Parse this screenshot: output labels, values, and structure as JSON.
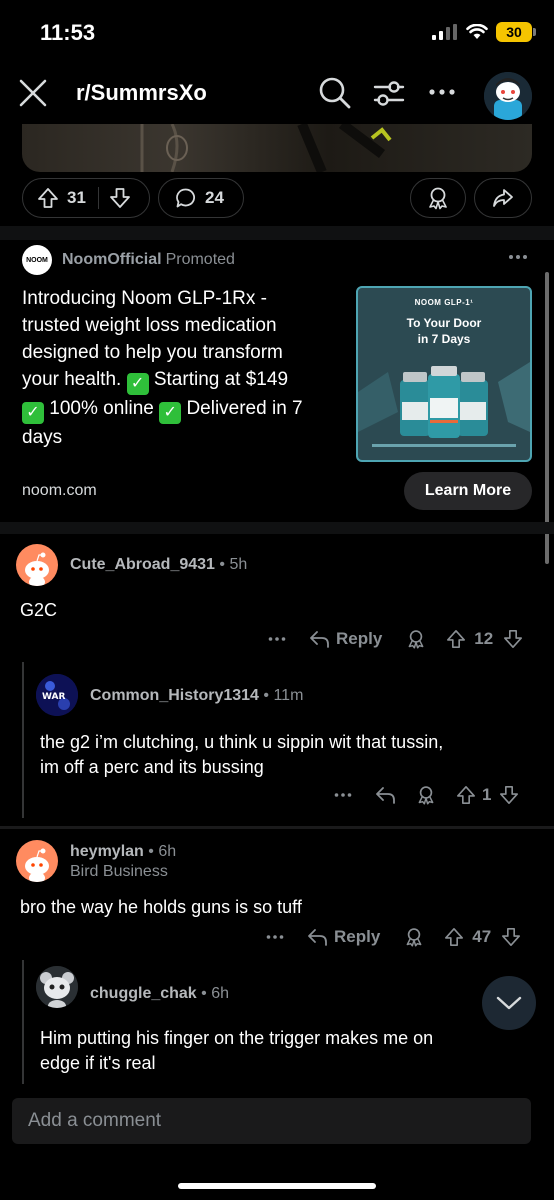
{
  "status": {
    "time": "11:53",
    "battery": "30"
  },
  "header": {
    "subreddit": "r/SummrsXo"
  },
  "post": {
    "upvotes": "31",
    "comments": "24"
  },
  "ad": {
    "advertiser": "NoomOfficial",
    "promoted_label": "Promoted",
    "logo_text": "NOOM",
    "text_lines": [
      "Introducing Noom GLP-1Rx -",
      "trusted weight loss medication",
      "designed to help you transform",
      "your health.",
      "Starting at $149",
      "100% online",
      "Delivered in 7",
      "days"
    ],
    "image": {
      "brand": "NOOM GLP-1¹",
      "headline_1": "To Your Door",
      "headline_2": "in 7 Days"
    },
    "domain": "noom.com",
    "cta": "Learn More"
  },
  "comments": [
    {
      "user": "Cute_Abroad_9431",
      "time": "5h",
      "body": "G2C",
      "reply_label": "Reply",
      "score": "12"
    },
    {
      "user": "Common_History1314",
      "time": "11m",
      "body_lines": [
        "the g2 i’m clutching, u think u sippin wit that tussin,",
        "im off a perc and its bussing"
      ],
      "score": "1"
    },
    {
      "user": "heymylan",
      "time": "6h",
      "flair": "Bird Business",
      "body": "bro the way he holds guns is so tuff",
      "reply_label": "Reply",
      "score": "47"
    },
    {
      "user": "chuggle_chak",
      "time": "6h",
      "body_lines": [
        "Him putting his finger on the trigger makes me on",
        "edge if it's real"
      ]
    }
  ],
  "composer": {
    "placeholder": "Add a comment"
  },
  "icons": {
    "close": "close-icon",
    "search": "search-icon",
    "filter": "filter-icon",
    "more": "more-icon",
    "upvote": "upvote-icon",
    "downvote": "downvote-icon",
    "comment": "comment-bubble-icon",
    "award": "award-icon",
    "share": "share-icon",
    "reply": "reply-arrow-icon",
    "scroll_down": "chevron-down-icon"
  },
  "colors": {
    "background": "#000000",
    "accent_orange": "#ff8b60",
    "battery": "#f5c400",
    "check_green": "#2fbf3a"
  }
}
